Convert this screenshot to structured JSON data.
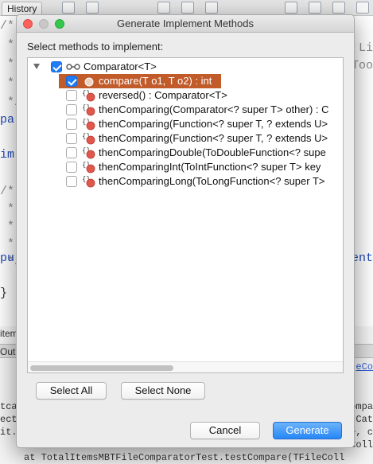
{
  "ide": {
    "history_tab": "History",
    "code_lines": [
      {
        "text": "/*",
        "cls": ""
      },
      {
        "text": " *",
        "cls": ""
      },
      {
        "text": " *",
        "cls": ""
      },
      {
        "text": " *",
        "cls": ""
      },
      {
        "text": " */",
        "cls": ""
      },
      {
        "text": "pa",
        "cls": "kw"
      },
      {
        "text": "",
        "cls": ""
      },
      {
        "text": "im",
        "cls": "kw"
      },
      {
        "text": "",
        "cls": ""
      },
      {
        "text": "/*",
        "cls": ""
      },
      {
        "text": " *",
        "cls": ""
      },
      {
        "text": " *",
        "cls": ""
      },
      {
        "text": " *",
        "cls": ""
      },
      {
        "text": " */",
        "cls": ""
      },
      {
        "text": "pu",
        "cls": "kw"
      },
      {
        "text": "",
        "cls": ""
      },
      {
        "text": "}",
        "cls": "dark"
      }
    ],
    "right_fragments": [
      {
        "text": "Li",
        "cls": ""
      },
      {
        "text": "Too",
        "cls": ""
      },
      {
        "text": "ent",
        "cls": "kw"
      }
    ],
    "bottom_tab_left": "item",
    "bottom_tab2": "Out",
    "output_lines": [
      "tcas",
      "ecte",
      "it.:"
    ],
    "output_right": [
      {
        "text": "eCo",
        "cls": "link"
      },
      {
        "text": "ompa",
        "cls": ""
      },
      {
        "text": ".Cat",
        "cls": ""
      },
      {
        "text": "e, c",
        "cls": ""
      },
      {
        "text": "Coll",
        "cls": ""
      }
    ],
    "output_last_line": "at TotalItemsMBTFileComparatorTest.testCompare(TFileColl"
  },
  "dialog": {
    "title": "Generate Implement Methods",
    "prompt": "Select methods to implement:",
    "tree": {
      "root": {
        "label": "Comparator<T>",
        "checked": true,
        "expanded": true,
        "icon": "interface-icon"
      },
      "methods": [
        {
          "label": "compare(T o1, T o2) : int",
          "checked": true,
          "selected": true,
          "icon": "abstract-method-icon"
        },
        {
          "label": "reversed() : Comparator<T>",
          "checked": false,
          "selected": false,
          "icon": "default-method-icon"
        },
        {
          "label": "thenComparing(Comparator<? super T> other) : C",
          "checked": false,
          "selected": false,
          "icon": "default-method-icon"
        },
        {
          "label": "thenComparing(Function<? super T, ? extends U>",
          "checked": false,
          "selected": false,
          "icon": "default-method-icon"
        },
        {
          "label": "thenComparing(Function<? super T, ? extends U>",
          "checked": false,
          "selected": false,
          "icon": "default-method-icon"
        },
        {
          "label": "thenComparingDouble(ToDoubleFunction<? supe",
          "checked": false,
          "selected": false,
          "icon": "default-method-icon"
        },
        {
          "label": "thenComparingInt(ToIntFunction<? super T> key",
          "checked": false,
          "selected": false,
          "icon": "default-method-icon"
        },
        {
          "label": "thenComparingLong(ToLongFunction<? super T>",
          "checked": false,
          "selected": false,
          "icon": "default-method-icon"
        }
      ]
    },
    "buttons": {
      "select_all": "Select All",
      "select_none": "Select None",
      "cancel": "Cancel",
      "generate": "Generate"
    },
    "colors": {
      "selection": "#c25b2a",
      "checkbox_checked": "#1f7cf6",
      "primary_button": "#2687f6"
    }
  }
}
